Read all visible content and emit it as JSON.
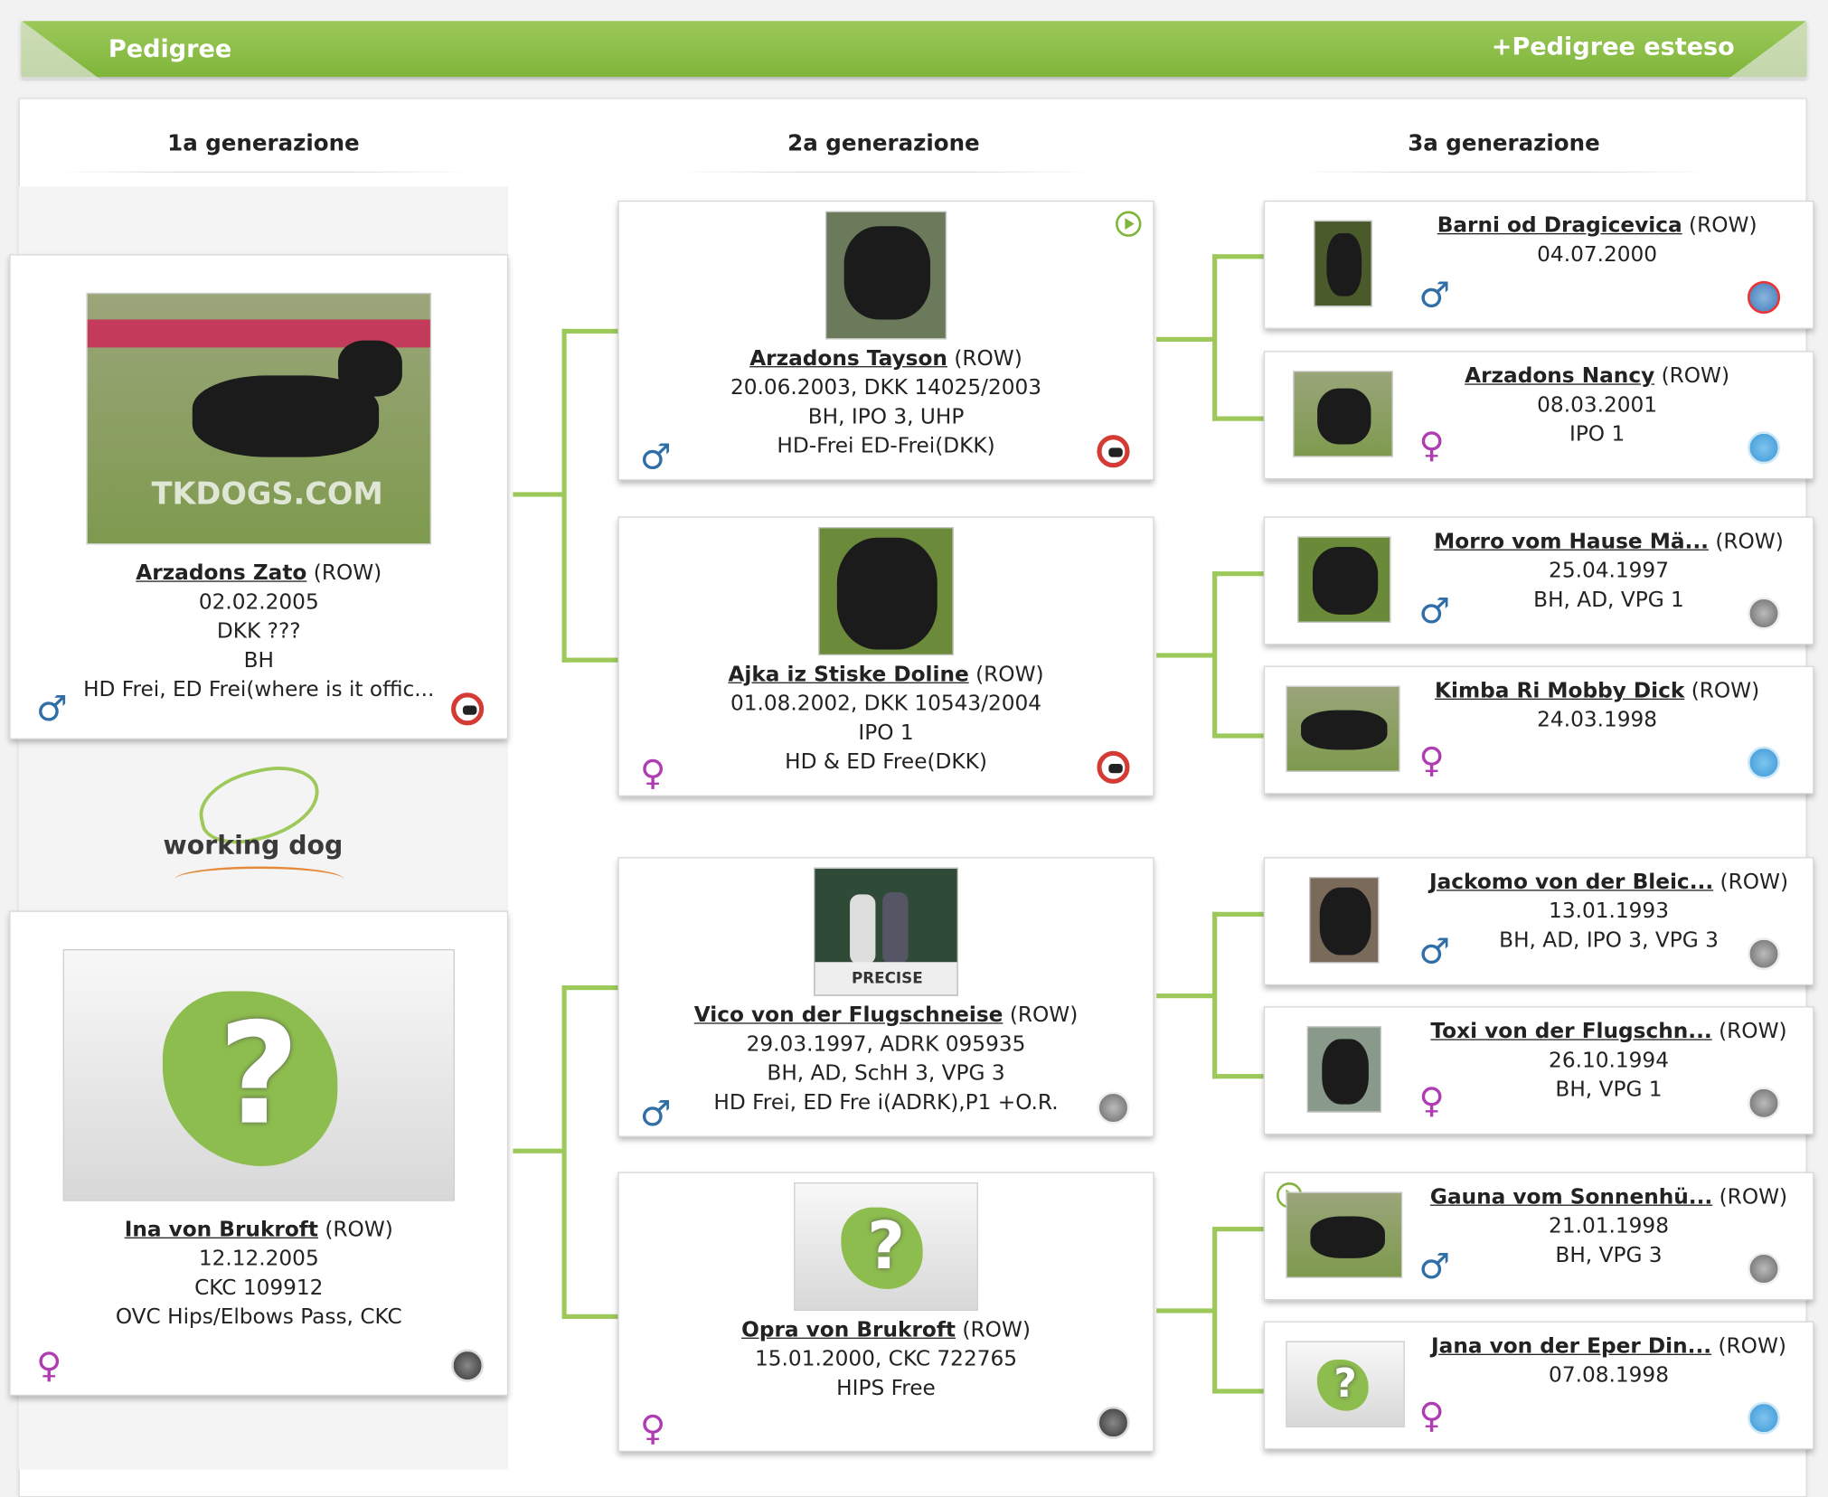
{
  "header": {
    "title": "Pedigree",
    "extended_link": "+Pedigree esteso"
  },
  "generations": [
    "1a generazione",
    "2a generazione",
    "3a generazione"
  ],
  "dogs": [
    {
      "name": "Arzadons Zato",
      "reg": "(ROW)",
      "lines": [
        "02.02.2005",
        "DKK ???",
        "BH",
        "HD Frei, ED Frei(where is it offic..."
      ],
      "sex": "♂",
      "badge": "dkk-icon"
    },
    {
      "name": "Ina von Brukroft",
      "reg": "(ROW)",
      "lines": [
        "12.12.2005",
        "CKC 109912",
        "OVC Hips/Elbows Pass, CKC"
      ],
      "sex": "♀",
      "badge": "ckc-icon"
    },
    {
      "name": "Arzadons Tayson",
      "reg": "(ROW)",
      "lines": [
        "20.06.2003, DKK 14025/2003",
        "BH, IPO 3, UHP",
        "HD-Frei ED-Frei(DKK)"
      ],
      "sex": "♂",
      "badge": "dkk-icon"
    },
    {
      "name": "Ajka iz Stiske Doline",
      "reg": "(ROW)",
      "lines": [
        "01.08.2002, DKK 10543/2004",
        "IPO 1",
        "HD & ED Free(DKK)"
      ],
      "sex": "♀",
      "badge": "dkk-icon"
    },
    {
      "name": "Vico von der Flugschneise",
      "reg": "(ROW)",
      "lines": [
        "29.03.1997, ADRK 095935",
        "BH, AD, SchH 3, VPG 3",
        "HD Frei, ED Fre i(ADRK),P1 +O.R."
      ],
      "sex": "♂",
      "badge": "adrk-icon"
    },
    {
      "name": "Opra von Brukroft",
      "reg": "(ROW)",
      "lines": [
        "15.01.2000, CKC 722765",
        "HIPS Free"
      ],
      "sex": "♀",
      "badge": "ckc-icon"
    },
    {
      "name": "Barni od Dragicevica",
      "reg": "(ROW)",
      "lines": [
        "04.07.2000"
      ],
      "sex": "♂",
      "badge": "rss-icon"
    },
    {
      "name": "Arzadons Nancy",
      "reg": "(ROW)",
      "lines": [
        "08.03.2001",
        "IPO 1"
      ],
      "sex": "♀",
      "badge": "fci-icon"
    },
    {
      "name": "Morro vom Hause Mä...",
      "reg": "(ROW)",
      "lines": [
        "25.04.1997",
        "BH, AD, VPG 1"
      ],
      "sex": "♂",
      "badge": "adrk-icon"
    },
    {
      "name": "Kimba Ri Mobby Dick",
      "reg": "(ROW)",
      "lines": [
        "24.03.1998"
      ],
      "sex": "♀",
      "badge": "fci-icon"
    },
    {
      "name": "Jackomo von der Bleic...",
      "reg": "(ROW)",
      "lines": [
        "13.01.1993",
        "BH, AD, IPO 3, VPG 3"
      ],
      "sex": "♂",
      "badge": "adrk-icon"
    },
    {
      "name": "Toxi von der Flugschn...",
      "reg": "(ROW)",
      "lines": [
        "26.10.1994",
        "BH, VPG 1"
      ],
      "sex": "♀",
      "badge": "adrk-icon"
    },
    {
      "name": "Gauna vom Sonnenhü...",
      "reg": "(ROW)",
      "lines": [
        "21.01.1998",
        "BH, VPG 3"
      ],
      "sex": "♂",
      "badge": "adrk-icon"
    },
    {
      "name": "Jana von der Eper Din...",
      "reg": "(ROW)",
      "lines": [
        "07.08.1998"
      ],
      "sex": "♀",
      "badge": "fci-icon"
    }
  ],
  "photo_text": {
    "watermark": "TKDOGS.COM",
    "precise": "PRECISE"
  },
  "logo": {
    "text": "working dog"
  }
}
